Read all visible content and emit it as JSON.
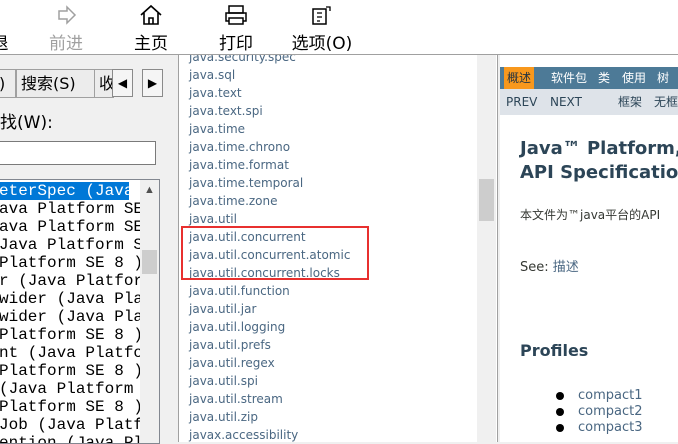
{
  "toolbar": {
    "back": {
      "label": "后退",
      "visible": "退",
      "icon": "back-arrow-icon"
    },
    "forward": {
      "label": "前进",
      "icon": "forward-arrow-icon",
      "enabled": false
    },
    "home": {
      "label": "主页",
      "icon": "home-icon"
    },
    "print": {
      "label": "打印",
      "icon": "printer-icon"
    },
    "options": {
      "label": "选项(O)",
      "icon": "options-icon"
    }
  },
  "left_pane": {
    "tabs": [
      {
        "label": ")"
      },
      {
        "label": "搜索(S)"
      },
      {
        "label": "收"
      }
    ],
    "find_label": "找(W):",
    "find_value": "",
    "results": [
      "eterSpec (Java",
      "ava Platform SE",
      "ava Platform SE",
      "Java Platform S",
      "Platform SE 8 )",
      "r (Java Platfor",
      "wider (Java Pla",
      "wider (Java Pla",
      "Platform SE 8 )",
      "nt (Java Platfo",
      "Platform SE 8 )",
      " (Java Platform",
      "Platform SE 8 )",
      "Job (Java Platf",
      "ention (Java Pl"
    ],
    "selected_index": 0
  },
  "packages": [
    "java.security.spec",
    "java.sql",
    "java.text",
    "java.text.spi",
    "java.time",
    "java.time.chrono",
    "java.time.format",
    "java.time.temporal",
    "java.time.zone",
    "java.util",
    "java.util.concurrent",
    "java.util.concurrent.atomic",
    "java.util.concurrent.locks",
    "java.util.function",
    "java.util.jar",
    "java.util.logging",
    "java.util.prefs",
    "java.util.regex",
    "java.util.spi",
    "java.util.stream",
    "java.util.zip",
    "javax.accessibility"
  ],
  "doc": {
    "nav": [
      "概述",
      "软件包",
      "类",
      "使用",
      "树"
    ],
    "subnav": [
      "PREV",
      "NEXT",
      "框架",
      "无框"
    ],
    "title_line1": "Java™ Platform,",
    "title_line2": "API Specification",
    "description": "本文件为™java平台的API",
    "see_label": "See:",
    "see_link": "描述",
    "profiles_heading": "Profiles",
    "profiles": [
      "compact1",
      "compact2",
      "compact3"
    ]
  },
  "colors": {
    "nav_bar": "#4d7a97",
    "nav_active": "#f8981d",
    "subnav": "#dee3e9",
    "link": "#4a6782",
    "selection": "#0078d7",
    "highlight_box": "#e8302f"
  }
}
